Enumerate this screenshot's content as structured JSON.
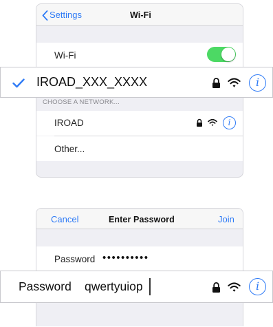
{
  "wifi_panel": {
    "back_label": "Settings",
    "title": "Wi-Fi",
    "wifi_toggle_label": "Wi-Fi",
    "wifi_enabled": true,
    "section_header": "CHOOSE A NETWORK...",
    "networks": [
      {
        "name": "IROAD",
        "locked": true
      },
      {
        "name": "Other..."
      }
    ]
  },
  "connected_callout": {
    "network_name": "IROAD_XXX_XXXX",
    "locked": true,
    "checkmark_icon": "checkmark-icon"
  },
  "password_panel": {
    "cancel_label": "Cancel",
    "title": "Enter Password",
    "join_label": "Join",
    "password_label": "Password",
    "password_masked": "••••••••••"
  },
  "password_callout": {
    "label": "Password",
    "value": "qwertyuiop"
  },
  "colors": {
    "accent": "#2f7bf6",
    "toggle_on": "#4cd964",
    "grouped_bg": "#efeff4"
  }
}
